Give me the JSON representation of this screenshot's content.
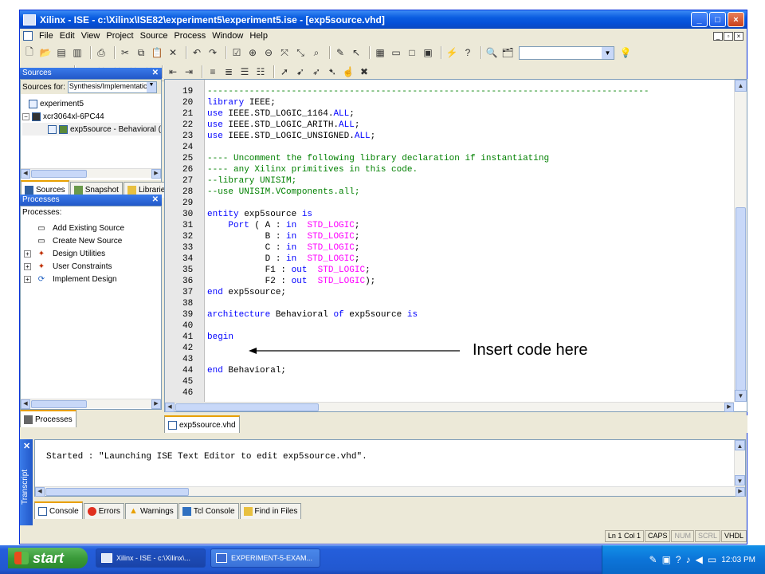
{
  "window": {
    "title": "Xilinx - ISE - c:\\Xilinx\\ISE82\\experiment5\\experiment5.ise - [exp5source.vhd]",
    "controls": {
      "minimize": "_",
      "maximize": "□",
      "close": "×"
    }
  },
  "menu": [
    "File",
    "Edit",
    "View",
    "Project",
    "Source",
    "Process",
    "Window",
    "Help"
  ],
  "toolbar": {
    "row1_icons": [
      "new-icon",
      "open-icon",
      "save-icon",
      "save-all-icon",
      "print-icon",
      "cut-icon",
      "copy-icon",
      "paste-icon",
      "delete-icon",
      "undo-icon",
      "redo-icon",
      "check-icon",
      "zoom-in-icon",
      "zoom-out-icon",
      "zoom-fit-icon",
      "zoom-full-icon",
      "search-icon",
      "edit-icon",
      "pointer-icon",
      "cascade-icon",
      "tile-icon",
      "window-icon",
      "window2-icon",
      "wand-icon",
      "help-pointer-icon",
      "find-icon",
      "find-in-files-icon"
    ],
    "search_combo_value": "",
    "light-bulb": "💡"
  },
  "sources_panel": {
    "header": "Sources",
    "sources_for_label": "Sources for:",
    "sources_for_value": "Synthesis/Implementatic",
    "tree": [
      {
        "label": "experiment5",
        "level": 0
      },
      {
        "label": "xcr3064xl-6PC44",
        "level": 1
      },
      {
        "label": "exp5source - Behavioral (",
        "level": 2
      }
    ],
    "tabs": [
      "Sources",
      "Snapshot",
      "Libraries"
    ]
  },
  "processes_panel": {
    "header": "Processes",
    "label": "Processes:",
    "items": [
      {
        "label": "Add Existing Source",
        "expandable": false
      },
      {
        "label": "Create New Source",
        "expandable": false
      },
      {
        "label": "Design Utilities",
        "expandable": true
      },
      {
        "label": "User Constraints",
        "expandable": true
      },
      {
        "label": "Implement Design",
        "expandable": true
      }
    ],
    "tab": "Processes"
  },
  "editor": {
    "file_tab": "exp5source.vhd",
    "lines": [
      {
        "n": "19",
        "segs": [
          {
            "t": "------------------------------------------------------------------------------------",
            "c": "cm"
          }
        ]
      },
      {
        "n": "20",
        "segs": [
          {
            "t": "library",
            "c": "kw"
          },
          {
            "t": " IEEE;",
            "c": ""
          }
        ]
      },
      {
        "n": "21",
        "segs": [
          {
            "t": "use",
            "c": "kw"
          },
          {
            "t": " IEEE.STD_LOGIC_1164.",
            "c": ""
          },
          {
            "t": "ALL",
            "c": "kw"
          },
          {
            "t": ";",
            "c": ""
          }
        ]
      },
      {
        "n": "22",
        "segs": [
          {
            "t": "use",
            "c": "kw"
          },
          {
            "t": " IEEE.STD_LOGIC_ARITH.",
            "c": ""
          },
          {
            "t": "ALL",
            "c": "kw"
          },
          {
            "t": ";",
            "c": ""
          }
        ]
      },
      {
        "n": "23",
        "segs": [
          {
            "t": "use",
            "c": "kw"
          },
          {
            "t": " IEEE.STD_LOGIC_UNSIGNED.",
            "c": ""
          },
          {
            "t": "ALL",
            "c": "kw"
          },
          {
            "t": ";",
            "c": ""
          }
        ]
      },
      {
        "n": "24",
        "segs": []
      },
      {
        "n": "25",
        "segs": [
          {
            "t": "---- Uncomment the following library declaration if instantiating",
            "c": "cm"
          }
        ]
      },
      {
        "n": "26",
        "segs": [
          {
            "t": "---- any Xilinx primitives in this code.",
            "c": "cm"
          }
        ]
      },
      {
        "n": "27",
        "segs": [
          {
            "t": "--library UNISIM;",
            "c": "cm"
          }
        ]
      },
      {
        "n": "28",
        "segs": [
          {
            "t": "--use UNISIM.VComponents.all;",
            "c": "cm"
          }
        ]
      },
      {
        "n": "29",
        "segs": []
      },
      {
        "n": "30",
        "segs": [
          {
            "t": "entity",
            "c": "kw"
          },
          {
            "t": " exp5source ",
            "c": ""
          },
          {
            "t": "is",
            "c": "kw"
          }
        ]
      },
      {
        "n": "31",
        "segs": [
          {
            "t": "    ",
            "c": ""
          },
          {
            "t": "Port",
            "c": "kw"
          },
          {
            "t": " ( A : ",
            "c": ""
          },
          {
            "t": "in",
            "c": "kw"
          },
          {
            "t": "  ",
            "c": ""
          },
          {
            "t": "STD_LOGIC",
            "c": "ty"
          },
          {
            "t": ";",
            "c": ""
          }
        ]
      },
      {
        "n": "32",
        "segs": [
          {
            "t": "           B : ",
            "c": ""
          },
          {
            "t": "in",
            "c": "kw"
          },
          {
            "t": "  ",
            "c": ""
          },
          {
            "t": "STD_LOGIC",
            "c": "ty"
          },
          {
            "t": ";",
            "c": ""
          }
        ]
      },
      {
        "n": "33",
        "segs": [
          {
            "t": "           C : ",
            "c": ""
          },
          {
            "t": "in",
            "c": "kw"
          },
          {
            "t": "  ",
            "c": ""
          },
          {
            "t": "STD_LOGIC",
            "c": "ty"
          },
          {
            "t": ";",
            "c": ""
          }
        ]
      },
      {
        "n": "34",
        "segs": [
          {
            "t": "           D : ",
            "c": ""
          },
          {
            "t": "in",
            "c": "kw"
          },
          {
            "t": "  ",
            "c": ""
          },
          {
            "t": "STD_LOGIC",
            "c": "ty"
          },
          {
            "t": ";",
            "c": ""
          }
        ]
      },
      {
        "n": "35",
        "segs": [
          {
            "t": "           F1 : ",
            "c": ""
          },
          {
            "t": "out",
            "c": "kw"
          },
          {
            "t": "  ",
            "c": ""
          },
          {
            "t": "STD_LOGIC",
            "c": "ty"
          },
          {
            "t": ";",
            "c": ""
          }
        ]
      },
      {
        "n": "36",
        "segs": [
          {
            "t": "           F2 : ",
            "c": ""
          },
          {
            "t": "out",
            "c": "kw"
          },
          {
            "t": "  ",
            "c": ""
          },
          {
            "t": "STD_LOGIC",
            "c": "ty"
          },
          {
            "t": ");",
            "c": ""
          }
        ]
      },
      {
        "n": "37",
        "segs": [
          {
            "t": "end",
            "c": "kw"
          },
          {
            "t": " exp5source;",
            "c": ""
          }
        ]
      },
      {
        "n": "38",
        "segs": []
      },
      {
        "n": "39",
        "segs": [
          {
            "t": "architecture",
            "c": "kw"
          },
          {
            "t": " Behavioral ",
            "c": ""
          },
          {
            "t": "of",
            "c": "kw"
          },
          {
            "t": " exp5source ",
            "c": ""
          },
          {
            "t": "is",
            "c": "kw"
          }
        ]
      },
      {
        "n": "40",
        "segs": []
      },
      {
        "n": "41",
        "segs": [
          {
            "t": "begin",
            "c": "kw"
          }
        ]
      },
      {
        "n": "42",
        "segs": []
      },
      {
        "n": "43",
        "segs": []
      },
      {
        "n": "44",
        "segs": [
          {
            "t": "end",
            "c": "kw"
          },
          {
            "t": " Behavioral;",
            "c": ""
          }
        ]
      },
      {
        "n": "45",
        "segs": []
      },
      {
        "n": "46",
        "segs": []
      }
    ]
  },
  "annotation": "Insert code here",
  "transcript": {
    "label": "Transcript",
    "console_text": "Started : \"Launching ISE Text Editor to edit exp5source.vhd\".",
    "tabs": [
      "Console",
      "Errors",
      "Warnings",
      "Tcl Console",
      "Find in Files"
    ]
  },
  "statusbar": [
    {
      "label": "Ln 1 Col 1",
      "dim": false
    },
    {
      "label": "CAPS",
      "dim": false
    },
    {
      "label": "NUM",
      "dim": true
    },
    {
      "label": "SCRL",
      "dim": true
    },
    {
      "label": "VHDL",
      "dim": false
    }
  ],
  "taskbar": {
    "start": "start",
    "items": [
      {
        "label": "Xilinx - ISE - c:\\Xilinx\\...",
        "active": true
      },
      {
        "label": "EXPERIMENT-5-EXAM...",
        "active": false
      }
    ],
    "clock": "12:03 PM"
  },
  "colors": {
    "keyword": "#0000ff",
    "type": "#ff00ff",
    "comment": "#008000",
    "titlebar": "#0a5ce0"
  }
}
